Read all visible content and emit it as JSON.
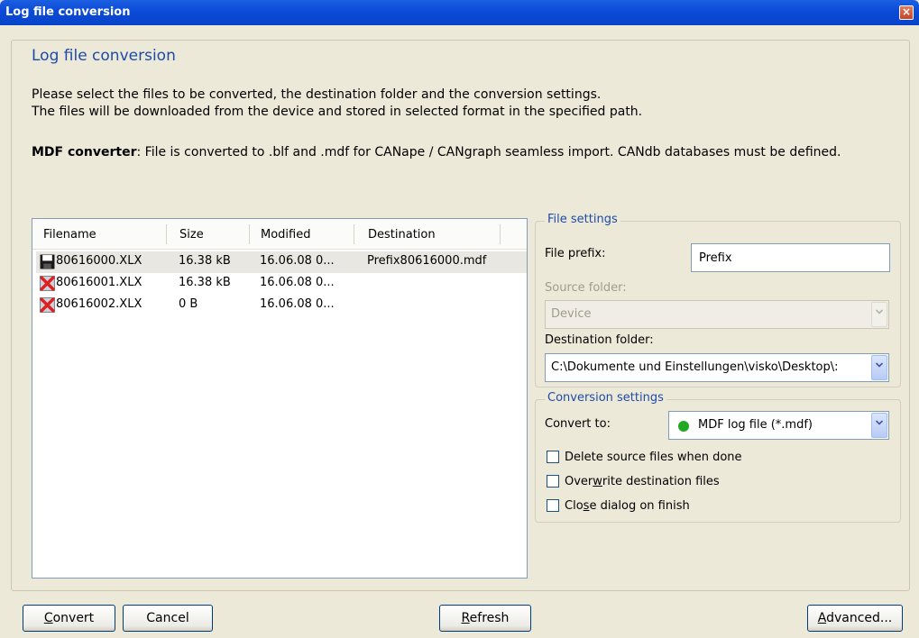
{
  "window": {
    "title": "Log file conversion"
  },
  "heading": "Log file conversion",
  "description": {
    "line1": "Please select the files to be converted, the destination folder and the conversion settings.",
    "line2": "The files will be downloaded from the device and stored in selected format in the specified path."
  },
  "mdf_note": {
    "label": "MDF converter",
    "text": ": File is converted to .blf and .mdf for CANape / CANgraph seamless import. CANdb databases must be defined."
  },
  "file_list": {
    "columns": [
      "Filename",
      "Size",
      "Modified",
      "Destination"
    ],
    "rows": [
      {
        "filename": "80616000.XLX",
        "size": "16.38 kB",
        "modified": "16.06.08 0...",
        "destination": "Prefix80616000.mdf",
        "icon": "floppy-disk-icon",
        "selected": true
      },
      {
        "filename": "80616001.XLX",
        "size": "16.38 kB",
        "modified": "16.06.08 0...",
        "destination": "",
        "icon": "error-x-icon",
        "selected": false
      },
      {
        "filename": "80616002.XLX",
        "size": "0 B",
        "modified": "16.06.08 0...",
        "destination": "",
        "icon": "error-x-icon",
        "selected": false
      }
    ]
  },
  "file_settings": {
    "title": "File settings",
    "prefix_label": "File prefix:",
    "prefix_value": "Prefix",
    "source_label": "Source folder:",
    "source_value": "Device",
    "destination_label": "Destination folder:",
    "destination_value": "C:\\Dokumente und Einstellungen\\visko\\Desktop\\:"
  },
  "conversion_settings": {
    "title": "Conversion settings",
    "convert_to_label": "Convert to:",
    "convert_to_value": "MDF log file (*.mdf)",
    "status_dot_color": "#22a822",
    "options": [
      {
        "pre": "Delete source files when done",
        "u": "",
        "post": "",
        "checked": false
      },
      {
        "pre": "Over",
        "u": "w",
        "post": "rite destination files",
        "checked": false
      },
      {
        "pre": "Clo",
        "u": "s",
        "post": "e dialog on finish",
        "checked": false
      }
    ]
  },
  "buttons": {
    "convert": {
      "u": "C",
      "rest": "onvert"
    },
    "cancel": "Cancel",
    "refresh": {
      "u": "R",
      "rest": "efresh"
    },
    "advanced": {
      "u": "A",
      "rest": "dvanced..."
    }
  },
  "colors": {
    "accent": "#1e4ba8",
    "titlebar": "#0b4ad8"
  }
}
